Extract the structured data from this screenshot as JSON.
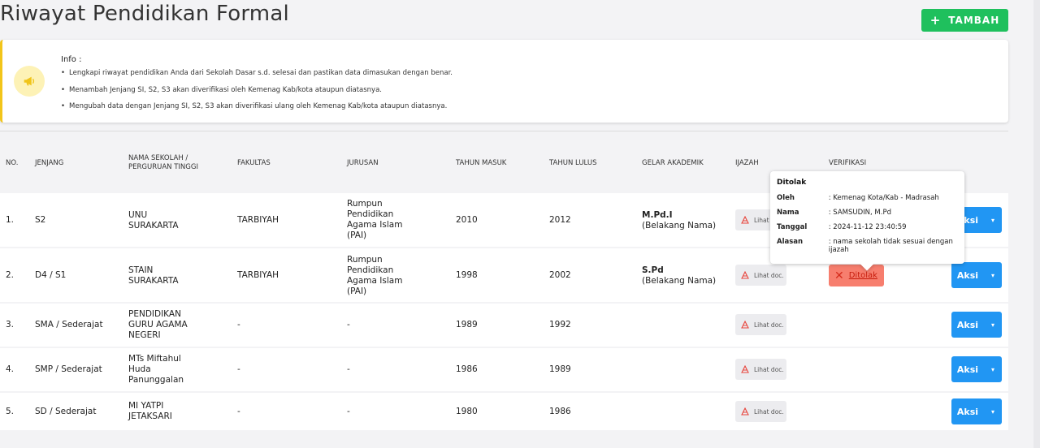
{
  "page": {
    "title": "Riwayat Pendidikan Formal",
    "add_button": "TAMBAH"
  },
  "info": {
    "title": "Info :",
    "items": [
      "Lengkapi riwayat pendidikan Anda dari Sekolah Dasar s.d. selesai dan pastikan data dimasukan dengan benar.",
      "Menambah Jenjang SI, S2, S3 akan diverifikasi oleh Kemenag Kab/kota ataupun diatasnya.",
      "Mengubah data dengan Jenjang SI, S2, S3 akan diverifikasi ulang oleh Kemenag Kab/kota ataupun diatasnya."
    ],
    "accent_color": "#f2c51a"
  },
  "table": {
    "headers": {
      "no": "NO.",
      "jenjang": "JENJANG",
      "nama_line1": "NAMA SEKOLAH /",
      "nama_line2": "PERGURUAN TINGGI",
      "fakultas": "FAKULTAS",
      "jurusan": "JURUSAN",
      "tahun_masuk": "TAHUN MASUK",
      "tahun_lulus": "TAHUN LULUS",
      "gelar": "GELAR AKADEMIK",
      "ijazah": "IJAZAH",
      "verifikasi": "VERIFIKASI"
    },
    "doc_label": "Lihat doc.",
    "aksi_label": "Aksi",
    "rows": [
      {
        "no": "1.",
        "jenjang": "S2",
        "nama": [
          "UNU",
          "SURAKARTA"
        ],
        "fakultas": "TARBIYAH",
        "jurusan": [
          "Rumpun",
          "Pendidikan",
          "Agama Islam",
          "(PAI)"
        ],
        "tahun_masuk": "2010",
        "tahun_lulus": "2012",
        "gelar": "M.Pd.I",
        "gelar_pos": "(Belakang Nama)"
      },
      {
        "no": "2.",
        "jenjang": "D4 / S1",
        "nama": [
          "STAIN",
          "SURAKARTA"
        ],
        "fakultas": "TARBIYAH",
        "jurusan": [
          "Rumpun",
          "Pendidikan",
          "Agama Islam",
          "(PAI)"
        ],
        "tahun_masuk": "1998",
        "tahun_lulus": "2002",
        "gelar": "S.Pd",
        "gelar_pos": "(Belakang Nama)",
        "verifikasi": "Ditolak"
      },
      {
        "no": "3.",
        "jenjang": "SMA / Sederajat",
        "nama": [
          "PENDIDIKAN",
          "GURU AGAMA",
          "NEGERI"
        ],
        "fakultas": "-",
        "jurusan": [
          "-"
        ],
        "tahun_masuk": "1989",
        "tahun_lulus": "1992"
      },
      {
        "no": "4.",
        "jenjang": "SMP / Sederajat",
        "nama": [
          "MTs Miftahul",
          "Huda",
          "Panunggalan"
        ],
        "fakultas": "-",
        "jurusan": [
          "-"
        ],
        "tahun_masuk": "1986",
        "tahun_lulus": "1989"
      },
      {
        "no": "5.",
        "jenjang": "SD / Sederajat",
        "nama": [
          "MI YATPI",
          "JETAKSARI"
        ],
        "fakultas": "-",
        "jurusan": [
          "-"
        ],
        "tahun_masuk": "1980",
        "tahun_lulus": "1986"
      }
    ]
  },
  "tooltip": {
    "title": "Ditolak",
    "oleh_label": "Oleh",
    "oleh": ": Kemenag Kota/Kab -  Madrasah",
    "nama_label": "Nama",
    "nama": ": SAMSUDIN, M.Pd",
    "tanggal_label": "Tanggal",
    "tanggal": ": 2024-11-12 23:40:59",
    "alasan_label": "Alasan",
    "alasan": ": nama sekolah tidak sesuai dengan ijazah"
  },
  "colors": {
    "add": "#1fc05d",
    "aksi": "#2196f3",
    "ditolak_bg": "#f77e6e",
    "ditolak_text": "#c61c0c"
  }
}
